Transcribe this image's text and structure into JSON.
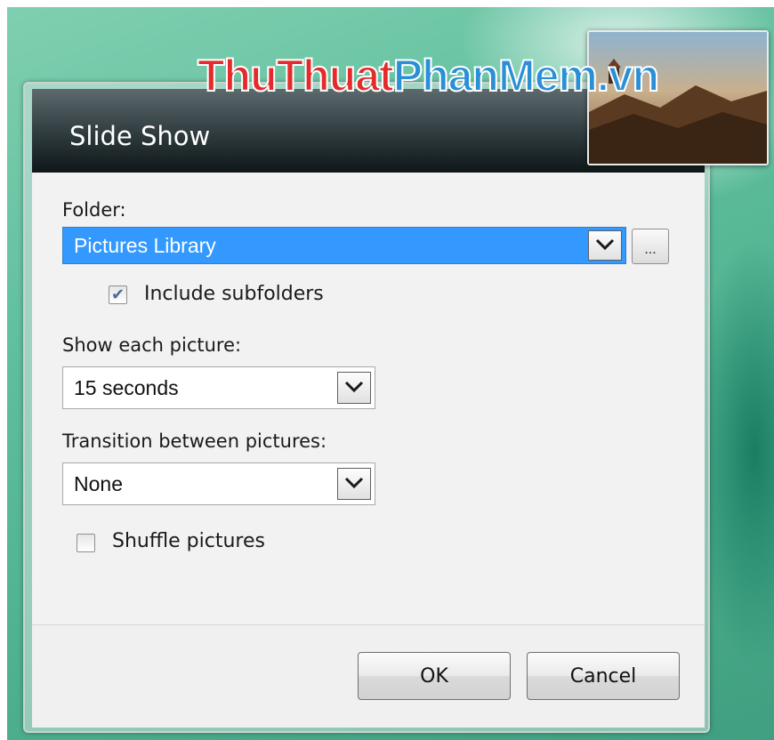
{
  "dialog": {
    "title": "Slide Show"
  },
  "folder": {
    "label": "Folder:",
    "selected": "Pictures Library",
    "browse_label": "..."
  },
  "include_subfolders": {
    "label": "Include subfolders",
    "checked": true
  },
  "show_each": {
    "label": "Show each picture:",
    "selected": "15 seconds"
  },
  "transition": {
    "label": "Transition between pictures:",
    "selected": "None"
  },
  "shuffle": {
    "label": "Shuffle pictures",
    "checked": false
  },
  "buttons": {
    "ok_label": "OK",
    "cancel_label": "Cancel"
  },
  "watermark": {
    "part1": "ThuThuat",
    "part2": "PhanMem",
    "part3": ".vn"
  },
  "colors": {
    "selection": "#3399ff",
    "watermark_red": "#e42a2a",
    "watermark_blue": "#2b8fd6",
    "desktop": "#5fbf9d"
  }
}
